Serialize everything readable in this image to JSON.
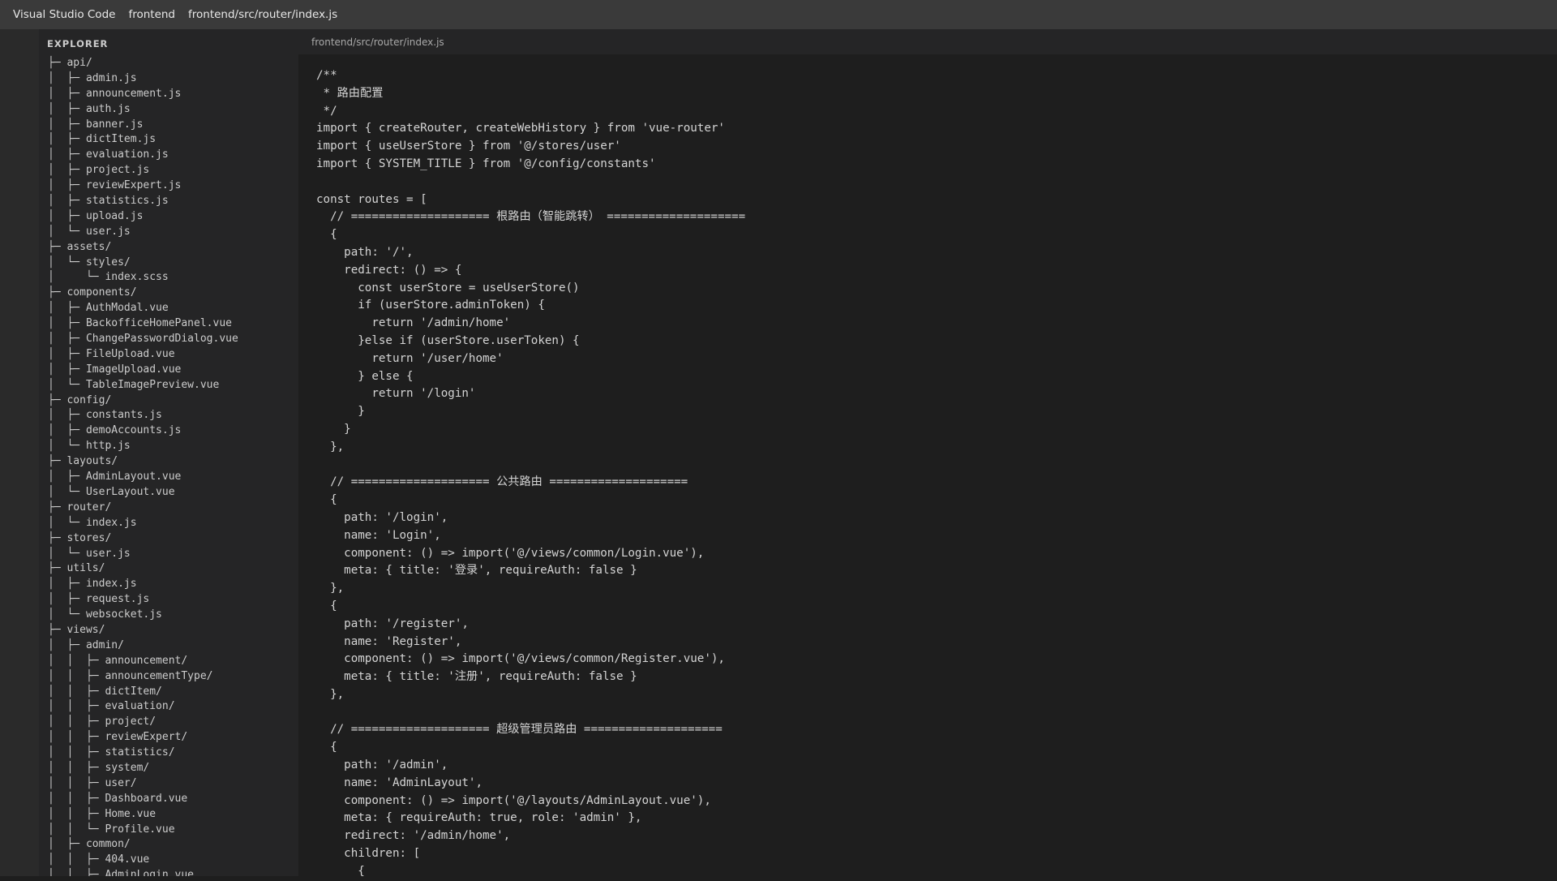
{
  "titlebar": {
    "app_name": "Visual Studio Code",
    "folder": "frontend",
    "file_path": "frontend/src/router/index.js"
  },
  "sidebar": {
    "title": "EXPLORER",
    "tree": [
      "├─ api/",
      "│  ├─ admin.js",
      "│  ├─ announcement.js",
      "│  ├─ auth.js",
      "│  ├─ banner.js",
      "│  ├─ dictItem.js",
      "│  ├─ evaluation.js",
      "│  ├─ project.js",
      "│  ├─ reviewExpert.js",
      "│  ├─ statistics.js",
      "│  ├─ upload.js",
      "│  └─ user.js",
      "├─ assets/",
      "│  └─ styles/",
      "│     └─ index.scss",
      "├─ components/",
      "│  ├─ AuthModal.vue",
      "│  ├─ BackofficeHomePanel.vue",
      "│  ├─ ChangePasswordDialog.vue",
      "│  ├─ FileUpload.vue",
      "│  ├─ ImageUpload.vue",
      "│  └─ TableImagePreview.vue",
      "├─ config/",
      "│  ├─ constants.js",
      "│  ├─ demoAccounts.js",
      "│  └─ http.js",
      "├─ layouts/",
      "│  ├─ AdminLayout.vue",
      "│  └─ UserLayout.vue",
      "├─ router/",
      "│  └─ index.js",
      "├─ stores/",
      "│  └─ user.js",
      "├─ utils/",
      "│  ├─ index.js",
      "│  ├─ request.js",
      "│  └─ websocket.js",
      "├─ views/",
      "│  ├─ admin/",
      "│  │  ├─ announcement/",
      "│  │  ├─ announcementType/",
      "│  │  ├─ dictItem/",
      "│  │  ├─ evaluation/",
      "│  │  ├─ project/",
      "│  │  ├─ reviewExpert/",
      "│  │  ├─ statistics/",
      "│  │  ├─ system/",
      "│  │  ├─ user/",
      "│  │  ├─ Dashboard.vue",
      "│  │  ├─ Home.vue",
      "│  │  └─ Profile.vue",
      "│  ├─ common/",
      "│  │  ├─ 404.vue",
      "│  │  ├─ AdminLogin.vue"
    ]
  },
  "editor": {
    "breadcrumb": "frontend/src/router/index.js",
    "lines": [
      "/**",
      " * 路由配置",
      " */",
      "import { createRouter, createWebHistory } from 'vue-router'",
      "import { useUserStore } from '@/stores/user'",
      "import { SYSTEM_TITLE } from '@/config/constants'",
      "",
      "const routes = [",
      "  // ==================== 根路由（智能跳转） ====================",
      "  {",
      "    path: '/',",
      "    redirect: () => {",
      "      const userStore = useUserStore()",
      "      if (userStore.adminToken) {",
      "        return '/admin/home'",
      "      }else if (userStore.userToken) {",
      "        return '/user/home'",
      "      } else {",
      "        return '/login'",
      "      }",
      "    }",
      "  },",
      "",
      "  // ==================== 公共路由 ====================",
      "  {",
      "    path: '/login',",
      "    name: 'Login',",
      "    component: () => import('@/views/common/Login.vue'),",
      "    meta: { title: '登录', requireAuth: false }",
      "  },",
      "  {",
      "    path: '/register',",
      "    name: 'Register',",
      "    component: () => import('@/views/common/Register.vue'),",
      "    meta: { title: '注册', requireAuth: false }",
      "  },",
      "",
      "  // ==================== 超级管理员路由 ====================",
      "  {",
      "    path: '/admin',",
      "    name: 'AdminLayout',",
      "    component: () => import('@/layouts/AdminLayout.vue'),",
      "    meta: { requireAuth: true, role: 'admin' },",
      "    redirect: '/admin/home',",
      "    children: [",
      "      {"
    ]
  }
}
